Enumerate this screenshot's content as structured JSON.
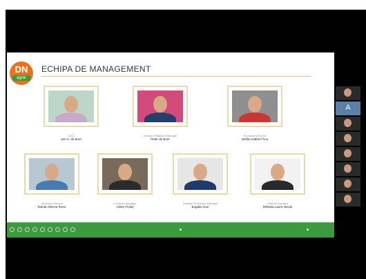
{
  "slide": {
    "logo_big": "DN",
    "logo_small": "agrar",
    "title": "ECHIPA DE MANAGEMENT"
  },
  "team": [
    {
      "role": "CEO",
      "name": "Jan G. de Boer",
      "bg": "#bcd7c9",
      "shirt": "#c7a9c9"
    },
    {
      "role": "Investor Relations Manager",
      "name": "Peter de Boer",
      "bg": "#d24a7a",
      "shirt": "#23406b"
    },
    {
      "role": "Economic Director",
      "name": "Ștefan Gabriel Tica",
      "bg": "#8f8f8f",
      "shirt": "#c93636"
    },
    {
      "role": "Technical Director",
      "name": "Marian Mircea Rusu",
      "bg": "#b8c8d2",
      "shirt": "#4a7ab0"
    },
    {
      "role": "Livestock Manager",
      "name": "Adina Trufaș",
      "bg": "#7a6a5a",
      "shirt": "#2b2b2b"
    },
    {
      "role": "Vegetal Production Manager",
      "name": "Bogdan Duri",
      "bg": "#e6e6e6",
      "shirt": "#1f3a6b"
    },
    {
      "role": "Chief Accountant",
      "name": "Mihaela Laura Nicula",
      "bg": "#f2f2f2",
      "shirt": "#2a2a2a"
    }
  ],
  "participants": [
    {
      "label": "",
      "type": "video"
    },
    {
      "label": "",
      "type": "avatar",
      "letter": "A"
    },
    {
      "label": "",
      "type": "video"
    },
    {
      "label": "",
      "type": "video"
    },
    {
      "label": "",
      "type": "video"
    },
    {
      "label": "",
      "type": "video"
    },
    {
      "label": "",
      "type": "video"
    },
    {
      "label": "",
      "type": "video"
    }
  ],
  "colors": {
    "accent_green": "#3b9a3c",
    "logo_orange": "#e8731c",
    "frame_gold": "#e9d9a8"
  }
}
